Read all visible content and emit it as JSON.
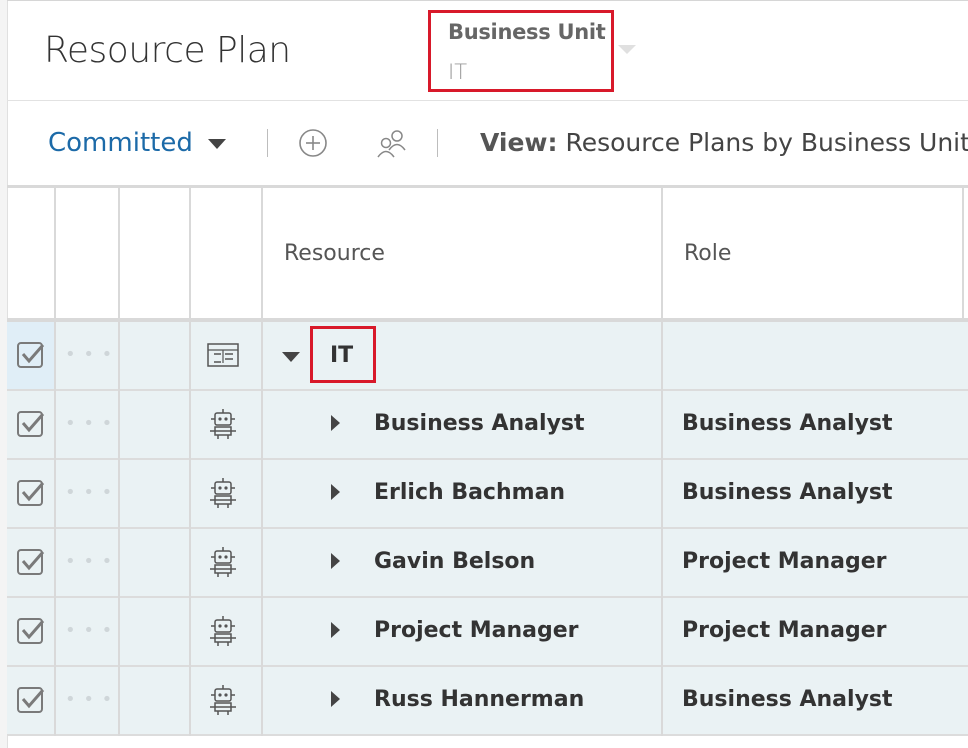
{
  "header": {
    "title": "Resource Plan",
    "business_unit": {
      "label": "Business Unit",
      "value": "IT"
    }
  },
  "toolbar": {
    "filter_label": "Committed",
    "add_icon": "plus-circle-icon",
    "people_icon": "people-icon",
    "view_prefix": "View:",
    "view_name": "Resource Plans by Business Unit"
  },
  "grid": {
    "columns": [
      "Resource",
      "Role"
    ],
    "group_row": {
      "name": "IT",
      "icon": "org-chart-icon"
    },
    "rows": [
      {
        "resource": "Business Analyst",
        "role": "Business Analyst",
        "icon": "robot-icon"
      },
      {
        "resource": "Erlich Bachman",
        "role": "Business Analyst",
        "icon": "robot-icon"
      },
      {
        "resource": "Gavin Belson",
        "role": "Project Manager",
        "icon": "robot-icon"
      },
      {
        "resource": "Project Manager",
        "role": "Project Manager",
        "icon": "robot-icon"
      },
      {
        "resource": "Russ Hannerman",
        "role": "Business Analyst",
        "icon": "robot-icon"
      }
    ]
  },
  "colors": {
    "accent_blue": "#1c6aa8",
    "highlight_red": "#d8192a",
    "row_background": "#eaf2f4"
  }
}
